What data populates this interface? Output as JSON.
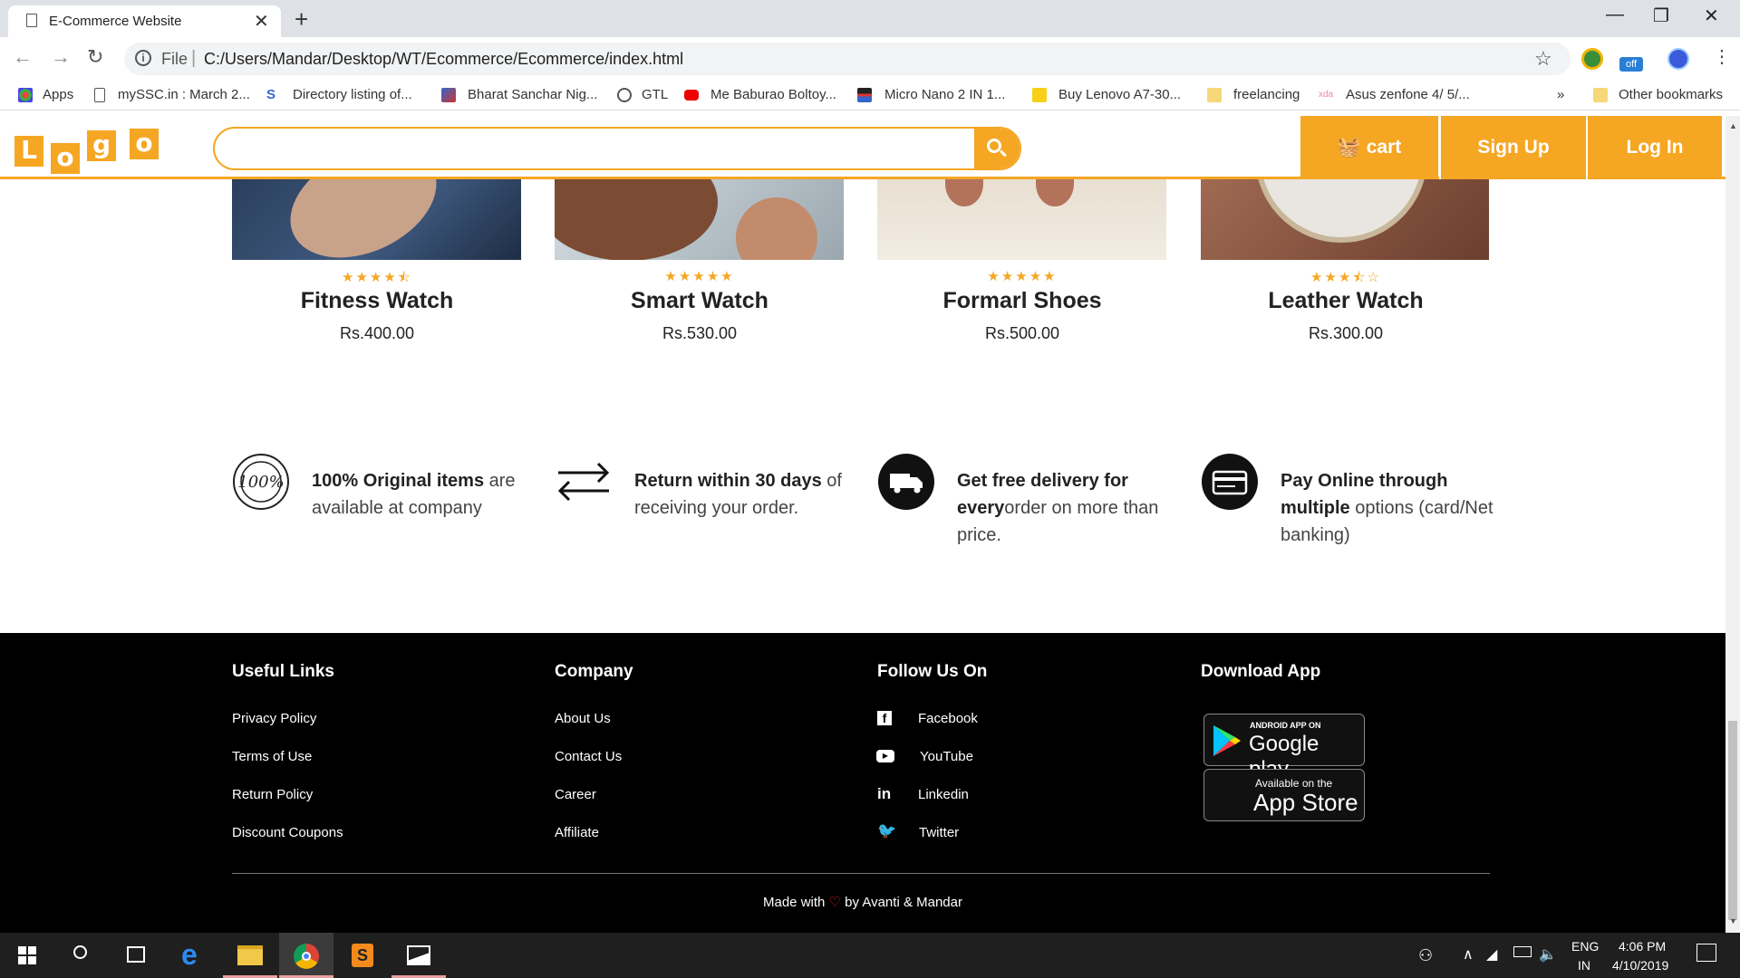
{
  "browser": {
    "tab_title": "E-Commerce Website",
    "new_tab": "+",
    "address_scheme": "File",
    "address_url": "C:/Users/Mandar/Desktop/WT/Ecommerce/Ecommerce/index.html",
    "extension_badge": "off",
    "bookmarks": [
      "Apps",
      "mySSC.in : March 2...",
      "Directory listing of...",
      "Bharat Sanchar Nig...",
      "GTL",
      "Me Baburao Boltoy...",
      "Micro Nano 2 IN 1...",
      "Buy Lenovo A7-30...",
      "freelancing",
      "Asus zenfone 4/ 5/...",
      "Other bookmarks"
    ],
    "more_bookmarks": "»"
  },
  "site": {
    "logo_letters": [
      "L",
      "o",
      "g",
      "o"
    ],
    "cart_label": "cart",
    "signup_label": "Sign Up",
    "login_label": "Log In",
    "accent_color": "#f5a623"
  },
  "products": [
    {
      "name": "Fitness Watch",
      "price": "Rs.400.00",
      "rating": 4.5
    },
    {
      "name": "Smart Watch",
      "price": "Rs.530.00",
      "rating": 5
    },
    {
      "name": "Formarl Shoes",
      "price": "Rs.500.00",
      "rating": 5
    },
    {
      "name": "Leather Watch",
      "price": "Rs.300.00",
      "rating": 3.5
    }
  ],
  "features": [
    {
      "icon": "original-badge-icon",
      "badge_text": "100%",
      "bold": "100% Original items",
      "rest": " are available at company"
    },
    {
      "icon": "return-arrows-icon",
      "bold": "Return within 30 days",
      "rest": " of receiving your order."
    },
    {
      "icon": "delivery-truck-icon",
      "bold": "Get free delivery for every",
      "rest": "order on more than price."
    },
    {
      "icon": "card-payment-icon",
      "bold": "Pay Online through multiple",
      "rest": " options (card/Net banking)"
    }
  ],
  "footer": {
    "useful_links": {
      "title": "Useful Links",
      "items": [
        "Privacy Policy",
        "Terms of Use",
        "Return Policy",
        "Discount Coupons"
      ]
    },
    "company": {
      "title": "Company",
      "items": [
        "About Us",
        "Contact Us",
        "Career",
        "Affiliate"
      ]
    },
    "follow": {
      "title": "Follow Us On",
      "items": [
        "Facebook",
        "YouTube",
        "Linkedin",
        "Twitter"
      ]
    },
    "download": {
      "title": "Download App",
      "google_small": "ANDROID APP ON",
      "google_big": "Google play",
      "apple_small": "Available on the",
      "apple_big": "App Store"
    },
    "made_with_prefix": "Made with",
    "made_with_suffix": "by Avanti & Mandar"
  },
  "taskbar": {
    "lang_top": "ENG",
    "lang_bottom": "IN",
    "time": "4:06 PM",
    "date": "4/10/2019"
  }
}
